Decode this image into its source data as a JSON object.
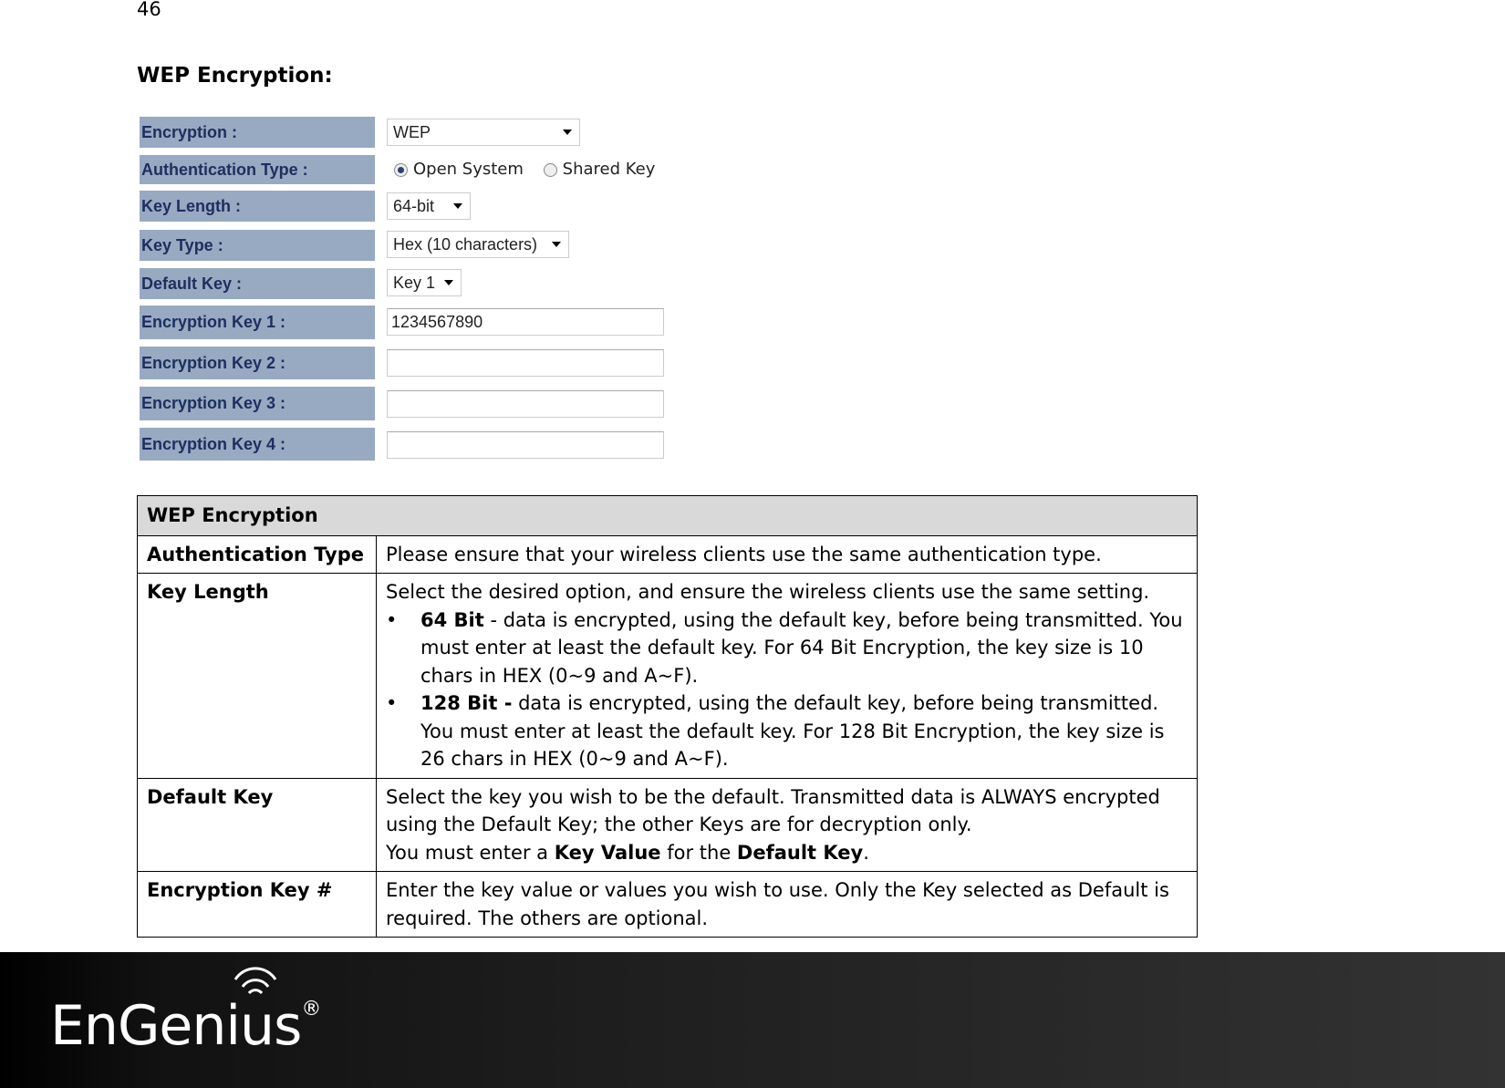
{
  "page_number": "46",
  "heading": "WEP Encryption:",
  "form": {
    "encryption": {
      "label": "Encryption :",
      "value": "WEP"
    },
    "auth_type": {
      "label": "Authentication Type :",
      "options": [
        "Open System",
        "Shared Key"
      ],
      "selected": "Open System"
    },
    "key_length": {
      "label": "Key Length :",
      "value": "64-bit"
    },
    "key_type": {
      "label": "Key Type :",
      "value": "Hex (10 characters)"
    },
    "default_key": {
      "label": "Default Key :",
      "value": "Key 1"
    },
    "keys": [
      {
        "label": "Encryption Key 1 :",
        "value": "1234567890"
      },
      {
        "label": "Encryption Key 2 :",
        "value": ""
      },
      {
        "label": "Encryption Key 3 :",
        "value": ""
      },
      {
        "label": "Encryption Key 4 :",
        "value": ""
      }
    ]
  },
  "table": {
    "header": "WEP Encryption",
    "rows": [
      {
        "key": "Authentication Type",
        "desc": "Please ensure that your wireless clients use the same authentication type."
      },
      {
        "key": "Key Length",
        "desc": "Select the desired option, and ensure the wireless clients use the same setting.",
        "bullets": [
          {
            "bold": "64 Bit",
            "text": " - data is encrypted, using the default key, before being transmitted. You must enter at least the default key. For 64 Bit Encryption, the key size is 10 chars in HEX (0~9 and A~F)."
          },
          {
            "bold": "128 Bit -",
            "text": " data is encrypted, using the default key, before being transmitted. You must enter at least the default key. For 128 Bit Encryption, the key size is 26 chars in HEX (0~9 and A~F)."
          }
        ]
      },
      {
        "key": "Default Key",
        "desc": "Select the key you wish to be the default. Transmitted data is ALWAYS encrypted using the Default Key; the other Keys are for decryption only.",
        "line2": {
          "a": "You must enter a ",
          "b": "Key Value",
          "c": " for the ",
          "d": "Default Key",
          "e": "."
        }
      },
      {
        "key": "Encryption Key #",
        "desc": "Enter the key value or values you wish to use. Only the Key selected as Default is required. The others are optional."
      }
    ]
  },
  "footer": {
    "logo": "EnGenius",
    "registered": "®"
  }
}
